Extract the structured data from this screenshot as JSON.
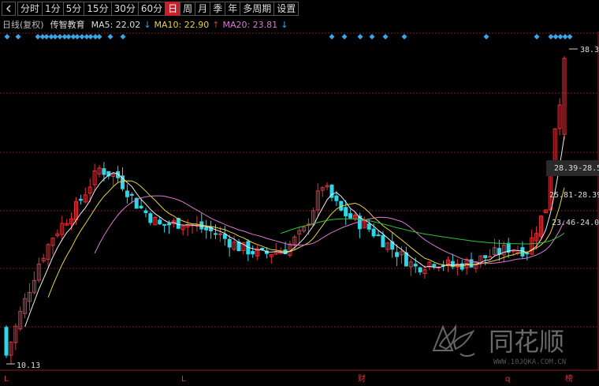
{
  "toolbar": {
    "periods": [
      "分时",
      "1分",
      "5分",
      "15分",
      "30分",
      "60分",
      "日",
      "周",
      "月",
      "季",
      "年",
      "多周期",
      "设置"
    ],
    "active_period": "日"
  },
  "infobar": {
    "mode": "日线(复权)",
    "stock": "传智教育",
    "ma5": "MA5: 22.02",
    "ma10": "MA10: 22.90",
    "ma20": "MA20: 23.81"
  },
  "axis": {
    "high_label": "38.3",
    "low_label": "10.13",
    "tooltip1": "28.39-28.5",
    "tooltip2": "25.81-28.39",
    "tooltip3": "23.46-24.00"
  },
  "date_markers": [
    "L",
    "L",
    "财",
    "q",
    "榜"
  ],
  "watermark": {
    "brand": "同花顺",
    "url": "WWW.10JQKA.COM.CN"
  },
  "colors": {
    "up": "#e8303a",
    "down": "#2fd6e8",
    "ma5": "#eeeeee",
    "ma10": "#e8d33c",
    "ma20": "#d77ad3",
    "ma60": "#2fc43a",
    "grid": "#7a1c1c",
    "marker": "#3aa6e8"
  }
}
